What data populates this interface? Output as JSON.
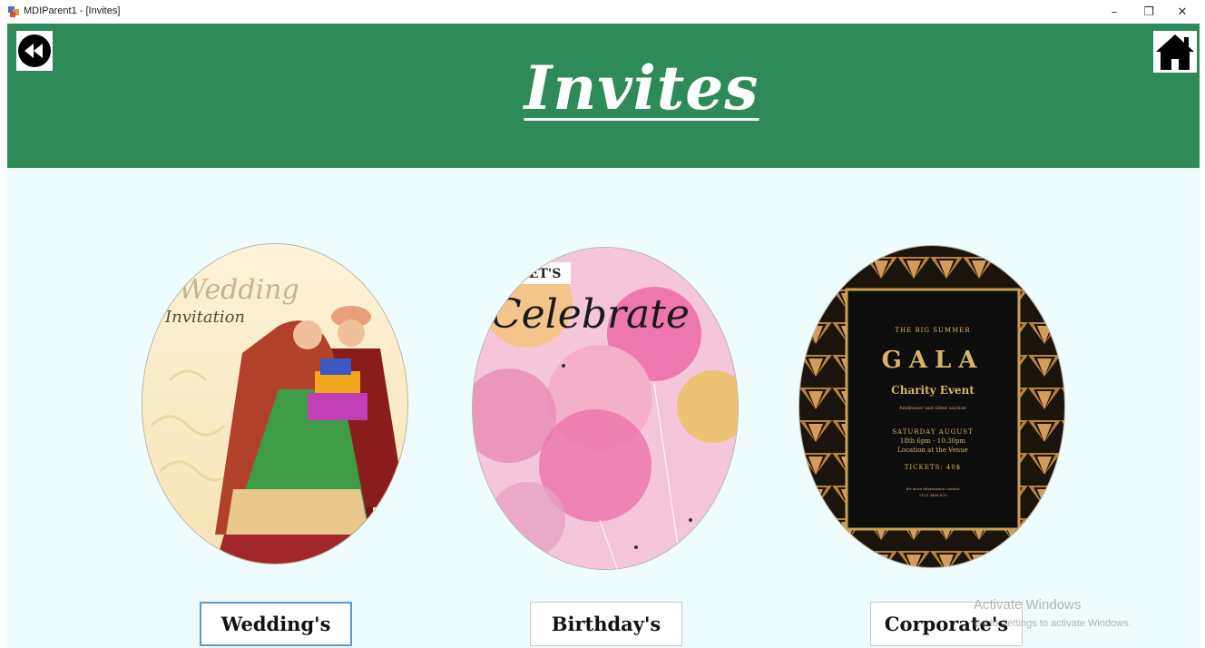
{
  "window": {
    "title": "MDIParent1 - [Invites]",
    "minimize": "–",
    "restore": "❐",
    "close": "✕"
  },
  "header": {
    "title": "Invites",
    "back_icon": "rewind-icon",
    "home_icon": "home-icon",
    "background": "#2e8b57"
  },
  "cards": [
    {
      "id": "wedding",
      "label": "Wedding's",
      "image_text": [
        "Wedding",
        "Invitation"
      ]
    },
    {
      "id": "birthday",
      "label": "Birthday's",
      "image_text": [
        "LET'S",
        "Celebrate"
      ]
    },
    {
      "id": "corporate",
      "label": "Corporate's",
      "image_text": [
        "THE BIG SUMMER",
        "GALA",
        "Charity Event",
        "fundraiser and silent auction",
        "SATURDAY AUGUST",
        "18th 6pm - 10:30pm",
        "Location at the Venue",
        "TICKETS: 40$",
        "for more information contact",
        "+123 3456 870"
      ]
    }
  ],
  "watermark": {
    "line1": "Activate Windows",
    "line2": "Go to Settings to activate Windows."
  },
  "colors": {
    "content_bg": "#eefcfd",
    "selected_border": "#5b9bd5"
  }
}
